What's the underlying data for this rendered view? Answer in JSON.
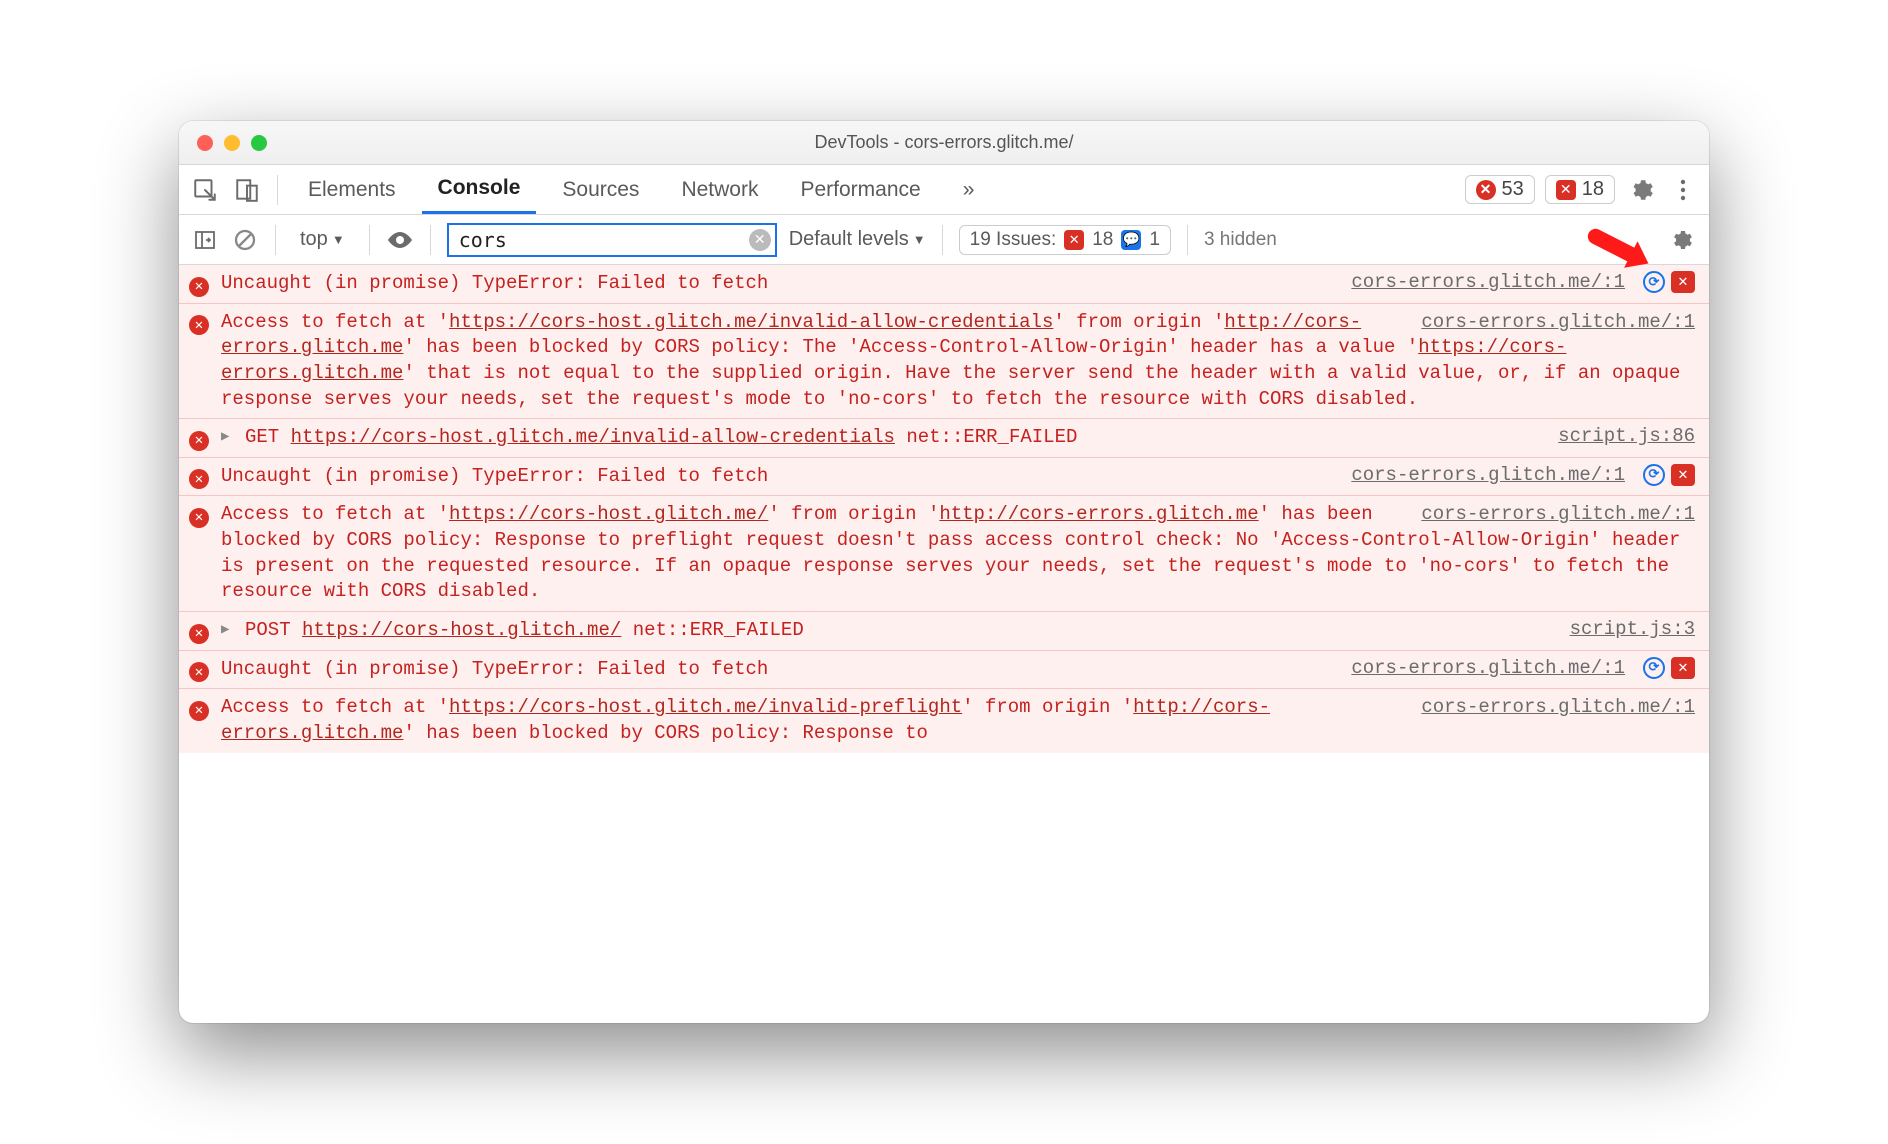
{
  "window": {
    "title": "DevTools - cors-errors.glitch.me/"
  },
  "tabs": {
    "elements": "Elements",
    "console": "Console",
    "sources": "Sources",
    "network": "Network",
    "performance": "Performance",
    "more": "»"
  },
  "counts": {
    "errors": "53",
    "issues_badge": "18"
  },
  "secondbar": {
    "context": "top",
    "filter_value": "cors",
    "levels": "Default levels",
    "issues_label": "19 Issues:",
    "issues_err": "18",
    "issues_info": "1",
    "hidden": "3 hidden"
  },
  "sources": {
    "home1": "cors-errors.glitch.me/:1",
    "script86": "script.js:86",
    "script3": "script.js:3"
  },
  "msgs": {
    "uncaught": "Uncaught (in promise) TypeError: Failed to fetch",
    "m2_a": "Access to fetch at '",
    "m2_u1": "https://cors-host.glitch.me/invalid-allow-credentials",
    "m2_b": "' from origin '",
    "m2_u2": "http://cors-errors.glitch.me",
    "m2_c": "' has been blocked by CORS policy: The 'Access-Control-Allow-Origin' header has a value '",
    "m2_u3": "https://cors-errors.glitch.me",
    "m2_d": "' that is not equal to the supplied origin. Have the server send the header with a valid value, or, if an opaque response serves your needs, set the request's mode to 'no-cors' to fetch the resource with CORS disabled.",
    "m3_method": "GET",
    "m3_url": "https://cors-host.glitch.me/invalid-allow-credentials",
    "m3_err": "net::ERR_FAILED",
    "m5_a": "Access to fetch at '",
    "m5_u1": "https://cors-host.glitch.me/",
    "m5_b": "' from origin '",
    "m5_u2": "http://cors-errors.glitch.me",
    "m5_c": "' has been blocked by CORS policy: Response to preflight request doesn't pass access control check: No 'Access-Control-Allow-Origin' header is present on the requested resource. If an opaque response serves your needs, set the request's mode to 'no-cors' to fetch the resource with CORS disabled.",
    "m6_method": "POST",
    "m6_url": "https://cors-host.glitch.me/",
    "m6_err": "net::ERR_FAILED",
    "m8_a": "Access to fetch at '",
    "m8_u1": "https://cors-host.glitch.me/invalid-preflight",
    "m8_b": "' from origin '",
    "m8_u2": "http://cors-errors.glitch.me",
    "m8_c": "' has been blocked by CORS policy: Response to"
  }
}
